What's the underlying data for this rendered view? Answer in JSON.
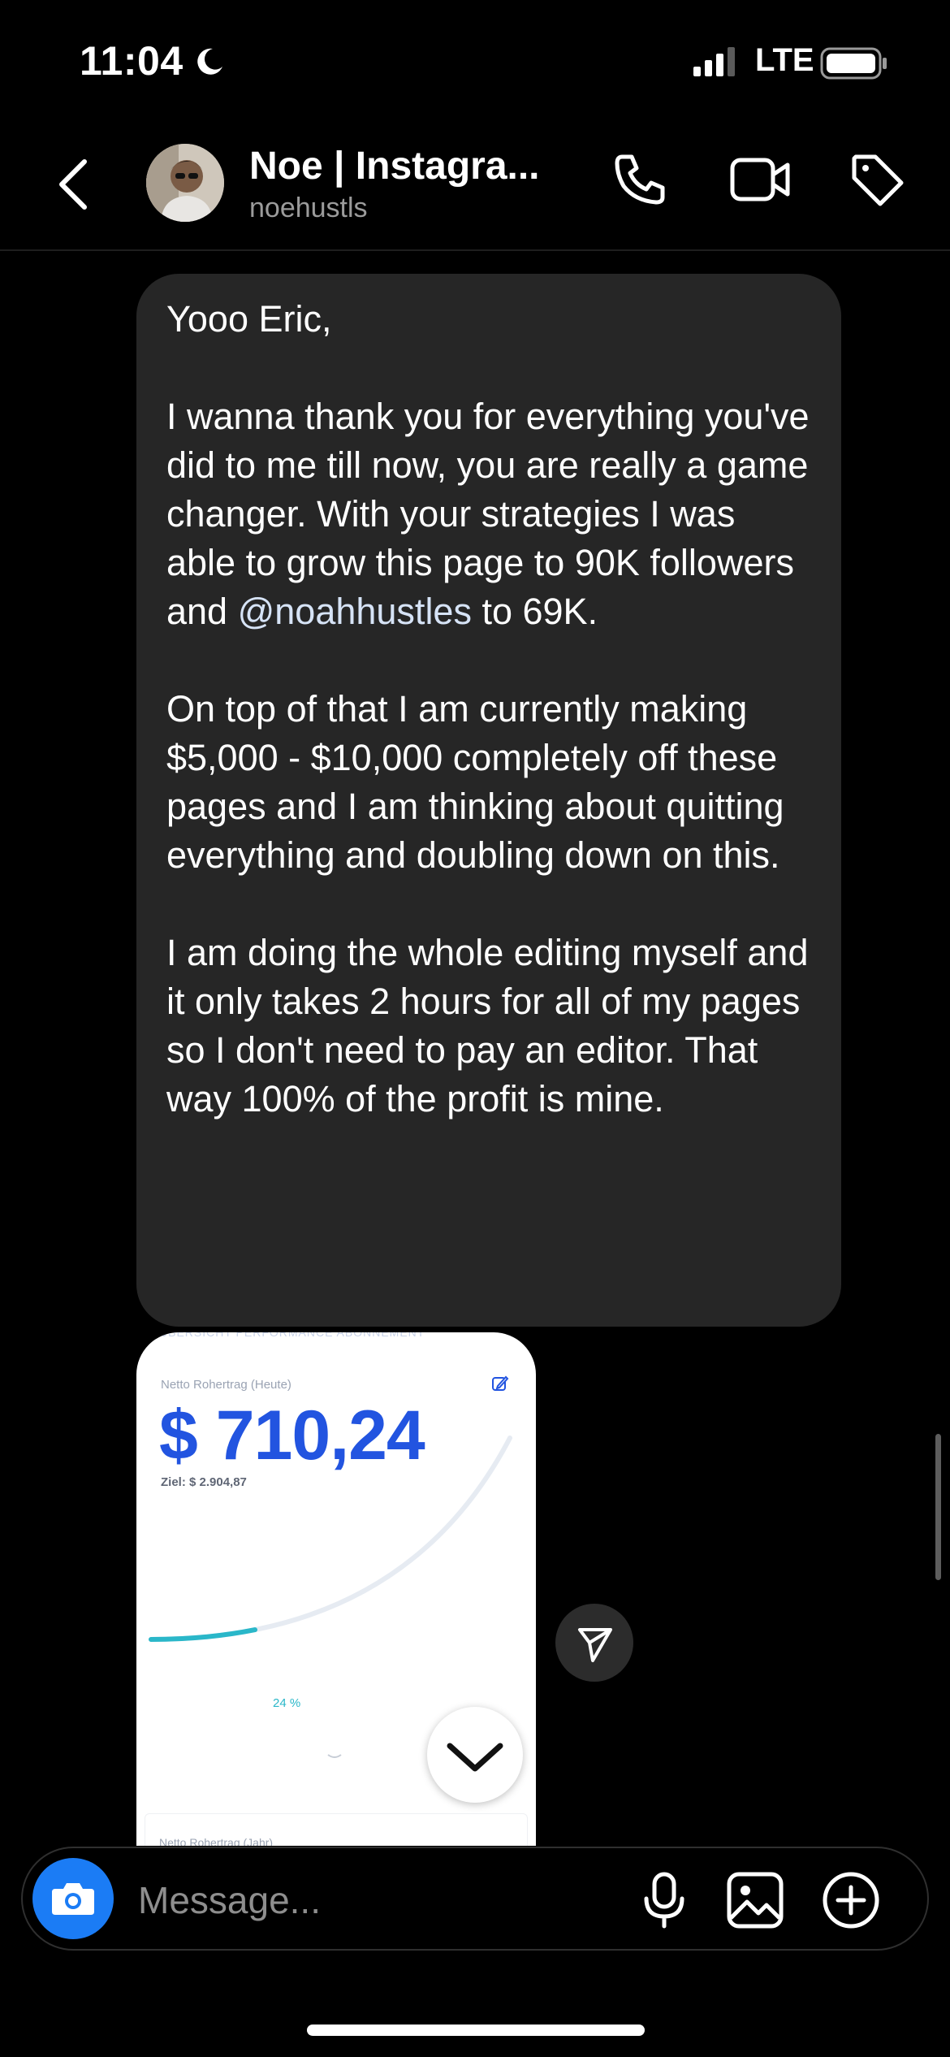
{
  "status_bar": {
    "time": "11:04",
    "network": "LTE",
    "icons": [
      "moon-icon",
      "signal-icon",
      "battery-icon"
    ]
  },
  "header": {
    "name": "Noe | Instagra...",
    "username": "noehustls",
    "icons": [
      "back-chevron-icon",
      "phone-icon",
      "video-camera-icon",
      "tag-icon"
    ]
  },
  "message": {
    "paragraphs": [
      "Yooo Eric,",
      "I wanna thank you for everything you've did to me till now, you are really a game changer. With your strategies I was able to grow this page to 90K followers and ",
      "On top of that I am currently making $5,000 - $10,000 completely off these pages and I am thinking about quitting everything and doubling down on this.",
      "I am doing the whole editing myself and it only takes 2 hours for all of my pages so I don't need to pay an editor. That way 100% of the profit is mine."
    ],
    "mention": "@noahhustles",
    "after_mention": " to 69K."
  },
  "image_card": {
    "tabs": "ÜBERSICHT    PERFORMANCE    ABONNEMENT",
    "label_today": "Netto Rohertrag (Heute)",
    "amount": "$ 710,24",
    "goal": "Ziel: $ 2.904,87",
    "percent": "24 %",
    "label_year": "Netto Rohertrag (Jahr)",
    "progress": 0.24,
    "colors": {
      "amount": "#2254e0",
      "progress": "#2ab7c9",
      "track": "#e6ebf2"
    }
  },
  "composer": {
    "placeholder": "Message...",
    "icons": [
      "camera-icon",
      "microphone-icon",
      "gallery-icon",
      "plus-circle-icon"
    ]
  },
  "colors": {
    "background": "#000000",
    "bubble": "#262626",
    "camera_button": "#1b7cf5"
  }
}
